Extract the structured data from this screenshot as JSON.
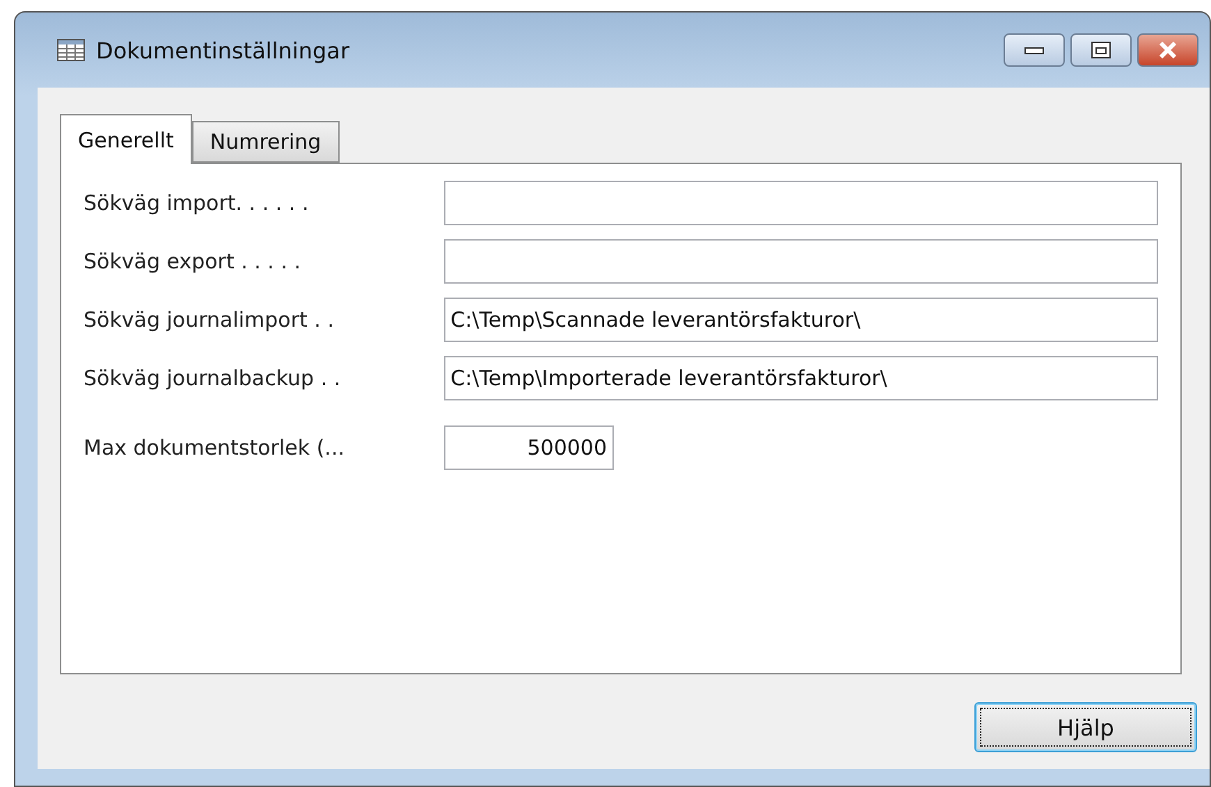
{
  "window": {
    "title": "Dokumentinställningar"
  },
  "tabs": [
    {
      "label": "Generellt",
      "selected": true
    },
    {
      "label": "Numrering",
      "selected": false
    }
  ],
  "fields": [
    {
      "label": "Sökväg import. . . . . .",
      "kind": "wide"
    },
    {
      "label": "Sökväg export . . . . .",
      "kind": "wide"
    },
    {
      "label": "Sökväg journalimport . .",
      "value": "C:\\Temp\\Scannade leverantörsfakturor\\",
      "kind": "wide"
    },
    {
      "label": "Sökväg journalbackup . .",
      "value": "C:\\Temp\\Importerade leverantörsfakturor\\",
      "kind": "wide"
    },
    {
      "label": "Max dokumentstorlek (...",
      "value": "500000",
      "kind": "number"
    }
  ],
  "buttons": [
    {
      "label": "Hjälp",
      "focused": true
    }
  ]
}
